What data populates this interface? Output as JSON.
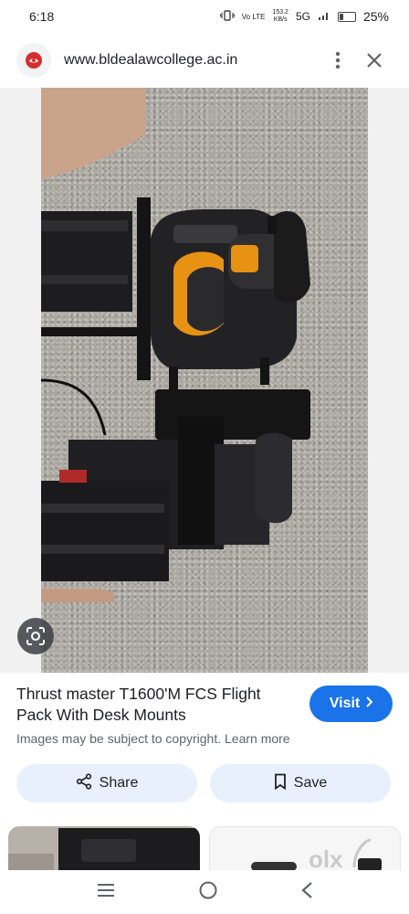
{
  "status_bar": {
    "time": "6:18",
    "network_speed": "153.2",
    "network_speed_unit": "KB/s",
    "volte_label": "Vo LTE",
    "network_type": "5G",
    "battery": "25%",
    "battery_level": 0.25
  },
  "browser": {
    "url": "www.bldealawcollege.ac.in",
    "icons": {
      "site": "site-logo-icon",
      "menu": "more-vert-icon",
      "close": "close-icon"
    }
  },
  "image_view": {
    "lens_icon": "google-lens-icon"
  },
  "result": {
    "title": "Thrust master T1600'M FCS Flight Pack With Desk Mounts",
    "visit_label": "Visit",
    "copyright_text": "Images may be subject to copyright.",
    "learn_more_label": "Learn more"
  },
  "actions": {
    "share_label": "Share",
    "save_label": "Save"
  },
  "related": {
    "watermark": "olx"
  },
  "colors": {
    "accent": "#1a73e8",
    "button_bg": "#e8f0fe",
    "text_secondary": "#5f6368"
  }
}
